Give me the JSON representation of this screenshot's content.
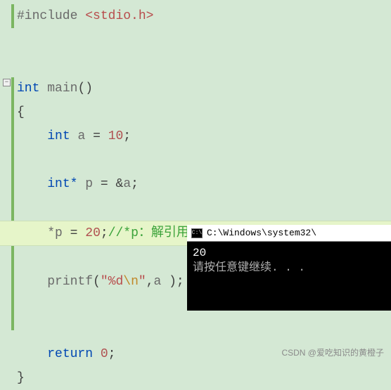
{
  "code": {
    "include_directive": "#include",
    "include_header": "<stdio.h>",
    "return_type": "int",
    "main_name": "main",
    "open_paren": "()",
    "brace_open": "{",
    "decl_type": "int",
    "decl_var": "a",
    "decl_assign": "=",
    "decl_value": "10",
    "semi": ";",
    "ptr_type": "int*",
    "ptr_name": "p",
    "ptr_assign": "=",
    "addr_op": "&",
    "addr_target": "a",
    "deref_lhs": "*p",
    "deref_assign": "=",
    "deref_value": "20",
    "deref_comment": "//*p：解引用操作符",
    "printf_name": "printf",
    "printf_open": "(",
    "printf_fmt_open": "\"",
    "printf_fmt_spec": "%d",
    "printf_fmt_esc": "\\n",
    "printf_fmt_close": "\"",
    "printf_comma": ",",
    "printf_arg": "a",
    "printf_close": " )",
    "return_kw": "return",
    "return_val": "0",
    "brace_close": "}"
  },
  "console": {
    "title": "C:\\Windows\\system32\\",
    "output_line1": "20",
    "output_line2": "请按任意键继续. . ."
  },
  "watermark": "CSDN @爱吃知识的黄橙子",
  "fold_glyph": "−"
}
